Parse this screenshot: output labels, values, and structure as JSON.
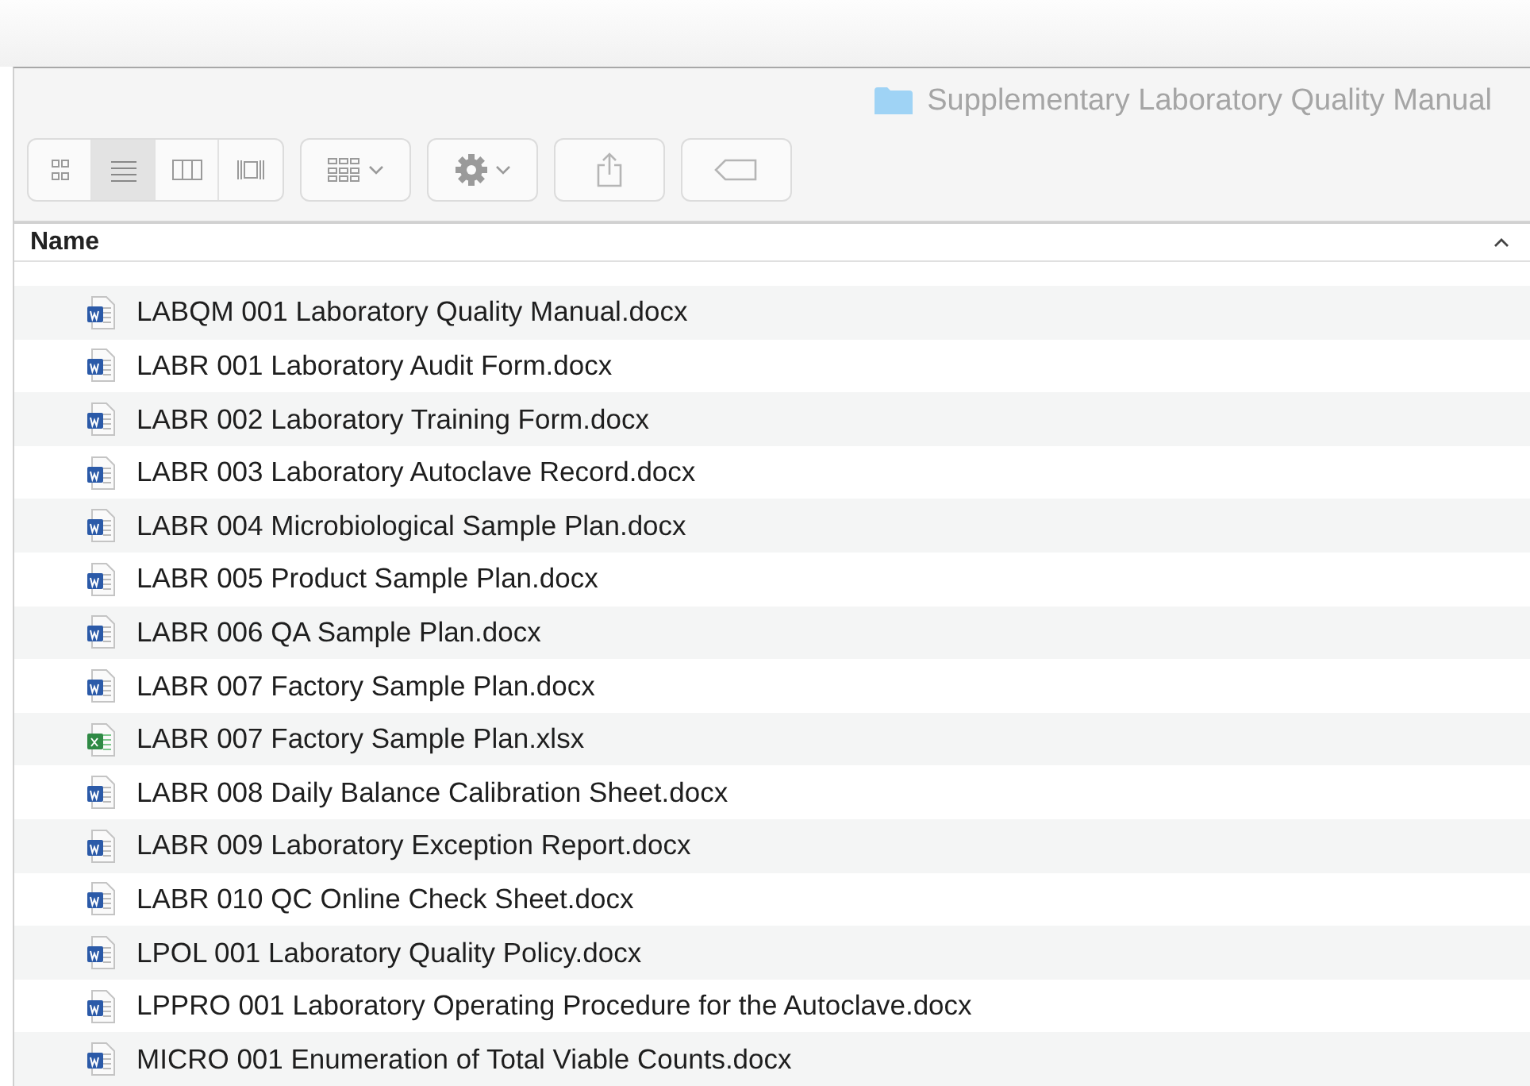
{
  "window": {
    "title": "Supplementary Laboratory Quality Manual"
  },
  "view_modes": [
    {
      "kind": "icons",
      "selected": false
    },
    {
      "kind": "list",
      "selected": true
    },
    {
      "kind": "columns",
      "selected": false
    },
    {
      "kind": "gallery",
      "selected": false
    }
  ],
  "table": {
    "columns": [
      {
        "label": "Name",
        "sorted_ascending": true
      }
    ],
    "rows": [
      {
        "name": "LABQM 001 Laboratory Quality Manual.docx",
        "kind": "word"
      },
      {
        "name": "LABR 001 Laboratory Audit Form.docx",
        "kind": "word"
      },
      {
        "name": "LABR 002 Laboratory Training Form.docx",
        "kind": "word"
      },
      {
        "name": "LABR 003 Laboratory Autoclave Record.docx",
        "kind": "word"
      },
      {
        "name": "LABR 004 Microbiological Sample Plan.docx",
        "kind": "word"
      },
      {
        "name": "LABR 005 Product Sample Plan.docx",
        "kind": "word"
      },
      {
        "name": "LABR 006 QA Sample Plan.docx",
        "kind": "word"
      },
      {
        "name": "LABR 007 Factory Sample Plan.docx",
        "kind": "word"
      },
      {
        "name": "LABR 007 Factory Sample Plan.xlsx",
        "kind": "excel"
      },
      {
        "name": "LABR 008 Daily Balance Calibration Sheet.docx",
        "kind": "word"
      },
      {
        "name": "LABR 009 Laboratory Exception Report.docx",
        "kind": "word"
      },
      {
        "name": "LABR 010 QC Online Check Sheet.docx",
        "kind": "word"
      },
      {
        "name": "LPOL 001 Laboratory Quality Policy.docx",
        "kind": "word"
      },
      {
        "name": "LPPRO 001 Laboratory Operating Procedure for the Autoclave.docx",
        "kind": "word"
      },
      {
        "name": "MICRO 001 Enumeration of Total Viable Counts.docx",
        "kind": "word"
      }
    ]
  }
}
